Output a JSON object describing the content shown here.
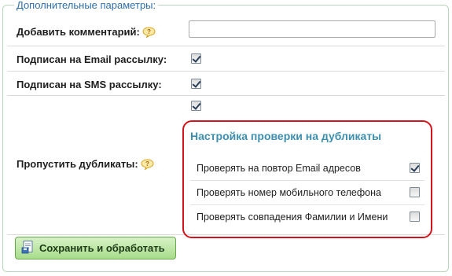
{
  "form": {
    "legend": "Дополнительные параметры:",
    "comment": {
      "label": "Добавить комментарий:",
      "value": "",
      "placeholder": ""
    },
    "email_subscribed": {
      "label": "Подписан на Email рассылку:",
      "checked": true
    },
    "sms_subscribed": {
      "label": "Подписан на SMS рассылку:",
      "checked": true
    },
    "skip_duplicates": {
      "label": "Пропустить дубликаты:",
      "checked": true
    },
    "duplicate_settings": {
      "title": "Настройка проверки на дубликаты",
      "items": [
        {
          "label": "Проверять на повтор Email адресов",
          "checked": true
        },
        {
          "label": "Проверять номер мобильного телефона",
          "checked": false
        },
        {
          "label": "Проверять совпадения Фамилии и Имени",
          "checked": false
        }
      ]
    },
    "save_button": {
      "label": "Сохранить и обработать",
      "icon": "save-document-icon"
    }
  },
  "colors": {
    "legend": "#2f6fa8",
    "dup_title": "#3d8fb0",
    "highlight_border": "#d4141b",
    "button_bg": "#a8dc8b"
  }
}
